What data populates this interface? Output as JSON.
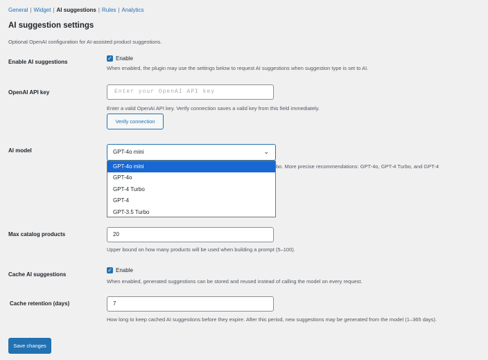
{
  "tabs": {
    "general": "General",
    "widget": "Widget",
    "ai": "AI suggestions",
    "rules": "Rules",
    "analytics": "Analytics",
    "separator": "|"
  },
  "page": {
    "title": "AI suggestion settings",
    "intro": "Optional OpenAI configuration for AI-assisted product suggestions."
  },
  "enable_ai": {
    "label": "Enable AI suggestions",
    "checked": true,
    "checkbox_label": "Enable",
    "description": "When enabled, the plugin may use the settings below to request AI suggestions when suggestion type is set to AI."
  },
  "api_key": {
    "label": "OpenAI API key",
    "value": "",
    "placeholder": "Enter your OpenAI API key",
    "description": "Enter a valid OpenAI API key. Verify connection saves a valid key from this field immediately.",
    "verify_label": "Verify connection"
  },
  "ai_model": {
    "label": "AI model",
    "selected": "GPT-4o mini",
    "options": [
      "GPT-4o mini",
      "GPT-4o",
      "GPT-4 Turbo",
      "GPT-4",
      "GPT-3.5 Turbo"
    ],
    "description_visible": "bo. More precise recommendations: GPT-4o, GPT-4 Turbo, and GPT-4"
  },
  "max_products": {
    "label": "Max catalog products",
    "value": "20",
    "description": "Upper bound on how many products will be used when building a prompt (5–100)."
  },
  "cache": {
    "label": "Cache AI suggestions",
    "checked": true,
    "checkbox_label": "Enable",
    "description": "When enabled, generated suggestions can be stored and reused instead of calling the model on every request."
  },
  "retention": {
    "label": "Cache retention (days)",
    "value": "7",
    "description": "How long to keep cached AI suggestions before they expire. After this period, new suggestions may be generated from the model (1–365 days)."
  },
  "save_label": "Save changes",
  "colors": {
    "accent": "#2271b1",
    "option_highlight": "#1967d2",
    "background": "#f0f0f1"
  },
  "icons": {
    "checkbox": "checkmark-icon",
    "select": "chevron-down-icon"
  }
}
